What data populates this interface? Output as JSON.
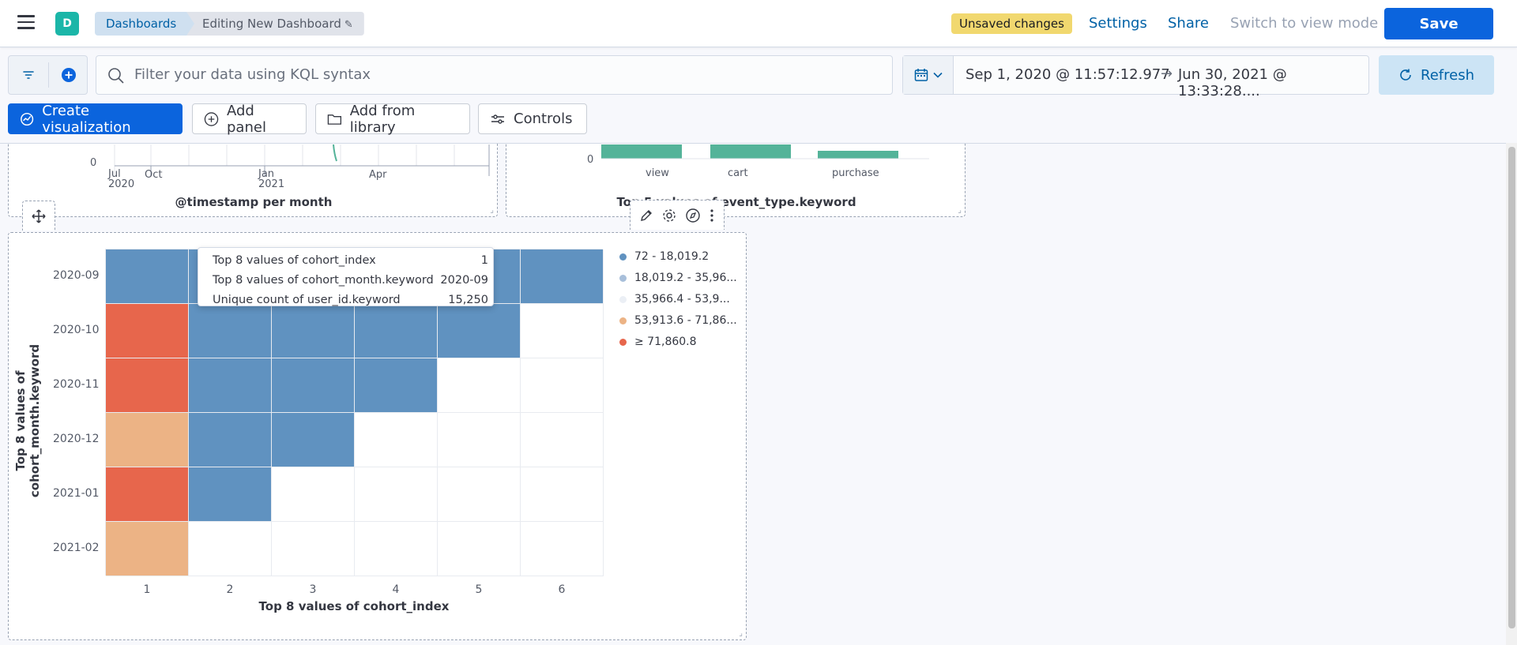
{
  "header": {
    "space_initial": "D",
    "breadcrumb": [
      "Dashboards",
      "Editing New Dashboard"
    ],
    "unsaved_badge": "Unsaved changes",
    "settings_label": "Settings",
    "share_label": "Share",
    "switch_view_label": "Switch to view mode",
    "save_label": "Save"
  },
  "query": {
    "placeholder": "Filter your data using KQL syntax",
    "date_start": "Sep 1, 2020 @ 11:57:12.977",
    "date_end": "Jun 30, 2021 @ 13:33:28....",
    "refresh_label": "Refresh"
  },
  "toolbar": {
    "create_visualization": "Create visualization",
    "add_panel": "Add panel",
    "add_from_library": "Add from library",
    "controls": "Controls"
  },
  "panels": {
    "timestamp_chart": {
      "title": "@timestamp per month",
      "y_tick": "0",
      "x_ticks": [
        {
          "main": "Jul",
          "sub": "2020"
        },
        {
          "main": "Oct",
          "sub": ""
        },
        {
          "main": "Jan",
          "sub": "2021"
        },
        {
          "main": "Apr",
          "sub": ""
        }
      ]
    },
    "event_type_chart": {
      "title": "Top 5 values of event_type.keyword",
      "y_tick": "0",
      "categories": [
        "view",
        "cart",
        "purchase"
      ],
      "color": "#54b399"
    },
    "cohort_heatmap": {
      "xlabel": "Top 8 values of cohort_index",
      "ylabel": "Top 8 values of cohort_month.keyword",
      "x_ticks": [
        "1",
        "2",
        "3",
        "4",
        "5",
        "6"
      ],
      "y_ticks": [
        "2020-09",
        "2020-10",
        "2020-11",
        "2020-12",
        "2021-01",
        "2021-02"
      ],
      "legend": [
        {
          "label": "72 - 18,019.2",
          "color": "#6092c0"
        },
        {
          "label": "18,019.2 - 35,96...",
          "color": "#a8bfda"
        },
        {
          "label": "35,966.4 - 53,9...",
          "color": "#ebeff5"
        },
        {
          "label": "53,913.6 - 71,86...",
          "color": "#ecb385"
        },
        {
          "label": "≥ 71,860.8",
          "color": "#e7664c"
        }
      ],
      "tooltip": [
        {
          "label": "Top 8 values of cohort_index",
          "value": "1"
        },
        {
          "label": "Top 8 values of cohort_month.keyword",
          "value": "2020-09"
        },
        {
          "label": "Unique count of user_id.keyword",
          "value": "15,250"
        }
      ]
    }
  },
  "chart_data": {
    "type": "heatmap",
    "title": "",
    "xlabel": "Top 8 values of cohort_index",
    "ylabel": "Top 8 values of cohort_month.keyword",
    "x": [
      "1",
      "2",
      "3",
      "4",
      "5",
      "6"
    ],
    "y": [
      "2020-09",
      "2020-10",
      "2020-11",
      "2020-12",
      "2021-01",
      "2021-02"
    ],
    "cell_bins": [
      [
        0,
        0,
        0,
        0,
        0,
        0
      ],
      [
        4,
        0,
        0,
        0,
        0,
        null
      ],
      [
        4,
        0,
        0,
        0,
        null,
        null
      ],
      [
        3,
        0,
        0,
        null,
        null,
        null
      ],
      [
        4,
        0,
        null,
        null,
        null,
        null
      ],
      [
        3,
        null,
        null,
        null,
        null,
        null
      ]
    ],
    "known_values": [
      {
        "x": "1",
        "y": "2020-09",
        "value": 15250
      }
    ]
  }
}
